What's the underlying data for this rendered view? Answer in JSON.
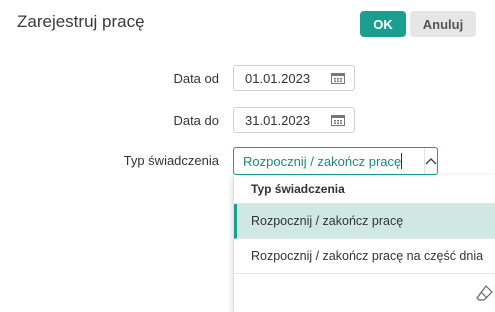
{
  "dialog": {
    "title": "Zarejestruj pracę",
    "ok_label": "OK",
    "cancel_label": "Anuluj"
  },
  "form": {
    "date_from": {
      "label": "Data od",
      "value": "01.01.2023",
      "icon": "calendar-icon"
    },
    "date_to": {
      "label": "Data do",
      "value": "31.01.2023",
      "icon": "calendar-icon"
    },
    "type": {
      "label": "Typ świadczenia",
      "value": "Rozpocznij / zakończ pracę",
      "icon": "chevron-up-icon"
    }
  },
  "dropdown": {
    "header": "Typ świadczenia",
    "options": [
      {
        "label": "Rozpocznij / zakończ pracę",
        "selected": true
      },
      {
        "label": "Rozpocznij / zakończ pracę na część dnia",
        "selected": false
      }
    ],
    "footer_icon": "eraser-icon"
  },
  "colors": {
    "accent": "#1a9e8f",
    "selected_bg": "#cfe8e3",
    "cancel_bg": "#e6e6e6"
  }
}
